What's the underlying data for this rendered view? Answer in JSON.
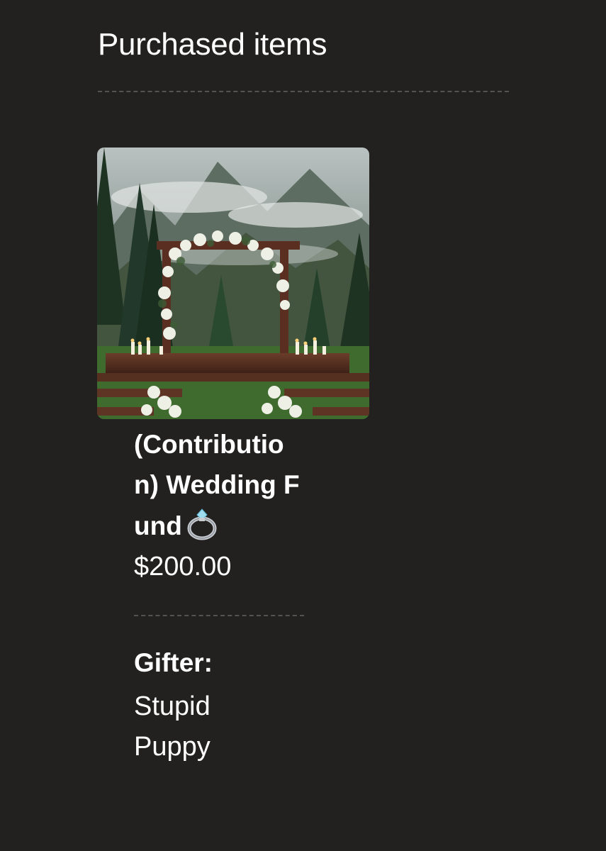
{
  "page": {
    "title": "Purchased items"
  },
  "item": {
    "name": "(Contribution) Wedding Fund",
    "icon": "ring-icon",
    "price": "$200.00",
    "image": "wedding-arch-photo"
  },
  "gifter": {
    "label": "Gifter:",
    "name": "Stupid Puppy"
  },
  "colors": {
    "background": "#222120",
    "text": "#ffffff",
    "divider": "#55534f"
  }
}
